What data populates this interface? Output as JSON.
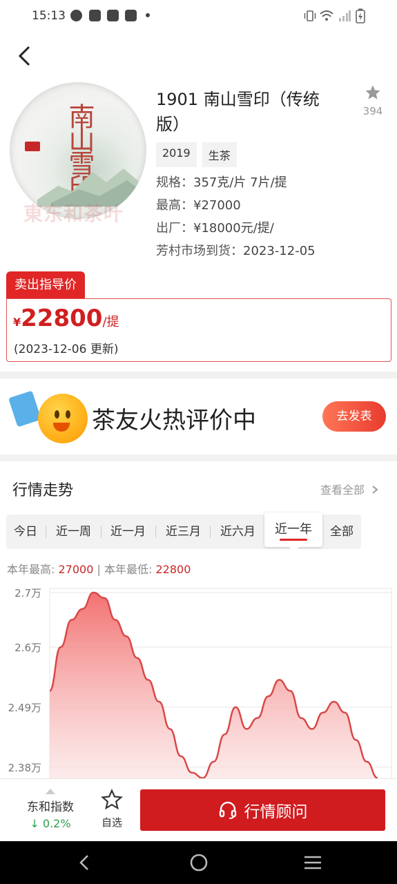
{
  "status_bar": {
    "time": "15:13",
    "left_icons": [
      "refresh-circle-icon",
      "mail-icon",
      "mail-icon",
      "mail-icon"
    ],
    "right_icons": [
      "vibrate-icon",
      "wifi-icon",
      "signal-icon",
      "battery-charging-icon"
    ]
  },
  "product": {
    "title": "1901 南山雪印（传统版）",
    "favorite_count": "394",
    "cake_title": "南山雪印",
    "watermark": "東东和茶叶",
    "tags": [
      "2019",
      "生茶"
    ],
    "specs": [
      {
        "label": "规格：",
        "value": "357克/片 7片/提"
      },
      {
        "label": "最高：",
        "value": "¥27000"
      },
      {
        "label": "出厂：",
        "value": "¥18000元/提/"
      },
      {
        "label": "芳村市场到货：",
        "value": "2023-12-05"
      }
    ]
  },
  "guide_price": {
    "tab_label": "卖出指导价",
    "currency": "¥",
    "value": "22800",
    "unit": "/提",
    "updated": "(2023-12-06 更新)"
  },
  "review_banner": {
    "text": "茶友火热评价中",
    "button": "去发表"
  },
  "trend": {
    "title": "行情走势",
    "view_all": "查看全部",
    "ranges": [
      "今日",
      "近一周",
      "近一月",
      "近三月",
      "近六月",
      "近一年",
      "全部"
    ],
    "active_range": "近一年",
    "stats": {
      "high_label": "本年最高:",
      "high_value": "27000",
      "separator": "|",
      "low_label": "本年最低:",
      "low_value": "22800"
    }
  },
  "chart_data": {
    "type": "area",
    "y_ticks": [
      "2.7万",
      "2.6万",
      "2.49万",
      "2.38万"
    ],
    "y_tick_values": [
      27000,
      26000,
      24900,
      23800
    ],
    "ylim": [
      23500,
      27100
    ],
    "series": [
      {
        "values": [
          25200,
          26000,
          26500,
          26700,
          27000,
          26900,
          26500,
          26200,
          25800,
          25400,
          25000,
          24500,
          24000,
          23700,
          23600,
          23900,
          24400,
          24900,
          24500,
          24700,
          25100,
          25400,
          25200,
          24700,
          24500,
          24800,
          25000,
          24800,
          24300,
          23900,
          23600
        ]
      }
    ],
    "grid": true,
    "color": "#e05555"
  },
  "bottom_bar": {
    "index_label": "东和指数",
    "index_change": "↓ 0.2%",
    "watch_label": "自选",
    "advisor_label": "行情顾问"
  },
  "colors": {
    "accent_red": "#d01b1f",
    "price_red": "#d01f1f",
    "down_green": "#2e9e4a"
  }
}
